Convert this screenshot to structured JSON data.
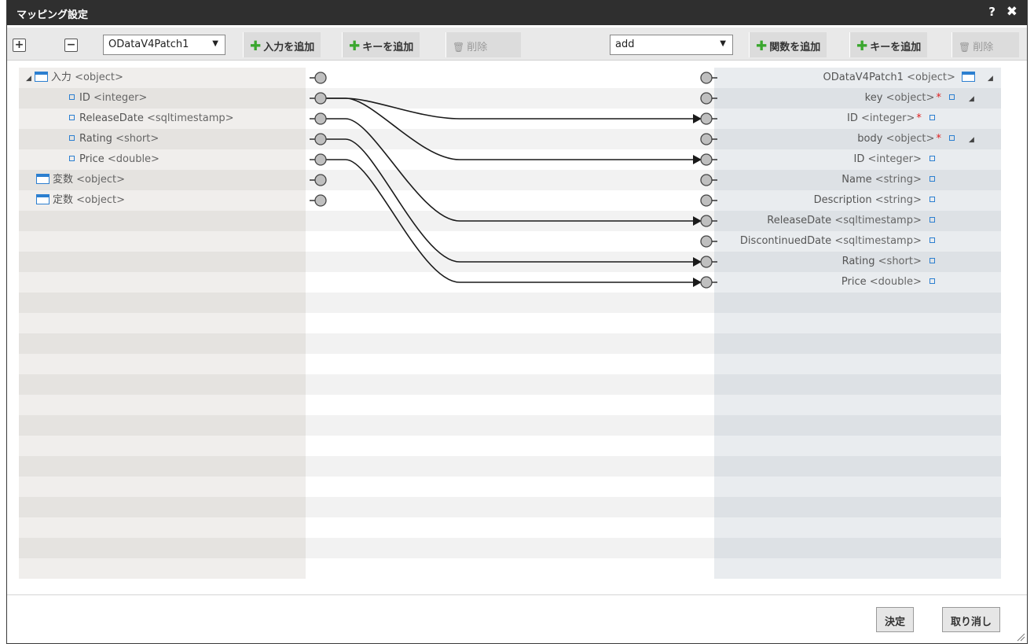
{
  "window": {
    "title": "マッピング設定",
    "help_label": "?",
    "close_label": "✖"
  },
  "toolbar": {
    "expand_label": "+",
    "collapse_label": "−",
    "input_select": {
      "value": "ODataV4Patch1"
    },
    "add_input_label": "入力を追加",
    "add_key_left_label": "キーを追加",
    "delete_left_label": "削除",
    "function_select": {
      "value": "add"
    },
    "add_function_label": "関数を追加",
    "add_key_right_label": "キーを追加",
    "delete_right_label": "削除"
  },
  "left_tree": [
    {
      "name": "入力",
      "type": "<object>",
      "kind": "object",
      "level": 0,
      "expanded": true
    },
    {
      "name": "ID",
      "type": "<integer>",
      "kind": "leaf",
      "level": 1
    },
    {
      "name": "ReleaseDate",
      "type": "<sqltimestamp>",
      "kind": "leaf",
      "level": 1
    },
    {
      "name": "Rating",
      "type": "<short>",
      "kind": "leaf",
      "level": 1
    },
    {
      "name": "Price",
      "type": "<double>",
      "kind": "leaf",
      "level": 1
    },
    {
      "name": "変数",
      "type": "<object>",
      "kind": "object",
      "level": 0
    },
    {
      "name": "定数",
      "type": "<object>",
      "kind": "object",
      "level": 0
    }
  ],
  "right_tree": [
    {
      "name": "ODataV4Patch1",
      "type": "<object>",
      "kind": "object",
      "required": false,
      "expandable": true
    },
    {
      "name": "key",
      "type": "<object>",
      "kind": "leaf",
      "required": true,
      "expandable": true
    },
    {
      "name": "ID",
      "type": "<integer>",
      "kind": "leaf",
      "required": true,
      "expandable": false
    },
    {
      "name": "body",
      "type": "<object>",
      "kind": "leaf",
      "required": true,
      "expandable": true
    },
    {
      "name": "ID",
      "type": "<integer>",
      "kind": "leaf",
      "required": false,
      "expandable": false
    },
    {
      "name": "Name",
      "type": "<string>",
      "kind": "leaf",
      "required": false,
      "expandable": false
    },
    {
      "name": "Description",
      "type": "<string>",
      "kind": "leaf",
      "required": false,
      "expandable": false
    },
    {
      "name": "ReleaseDate",
      "type": "<sqltimestamp>",
      "kind": "leaf",
      "required": false,
      "expandable": false
    },
    {
      "name": "DiscontinuedDate",
      "type": "<sqltimestamp>",
      "kind": "leaf",
      "required": false,
      "expandable": false
    },
    {
      "name": "Rating",
      "type": "<short>",
      "kind": "leaf",
      "required": false,
      "expandable": false
    },
    {
      "name": "Price",
      "type": "<double>",
      "kind": "leaf",
      "required": false,
      "expandable": false
    }
  ],
  "mappings": [
    {
      "from": 1,
      "to": 2
    },
    {
      "from": 1,
      "to": 4
    },
    {
      "from": 2,
      "to": 7
    },
    {
      "from": 3,
      "to": 9
    },
    {
      "from": 4,
      "to": 10
    }
  ],
  "footer": {
    "ok_label": "決定",
    "cancel_label": "取り消し"
  },
  "colors": {
    "title_bar": "#2f2f2f",
    "accent_plus": "#3aa72e",
    "object_icon": "#2c7fd0",
    "required": "#e02020"
  }
}
